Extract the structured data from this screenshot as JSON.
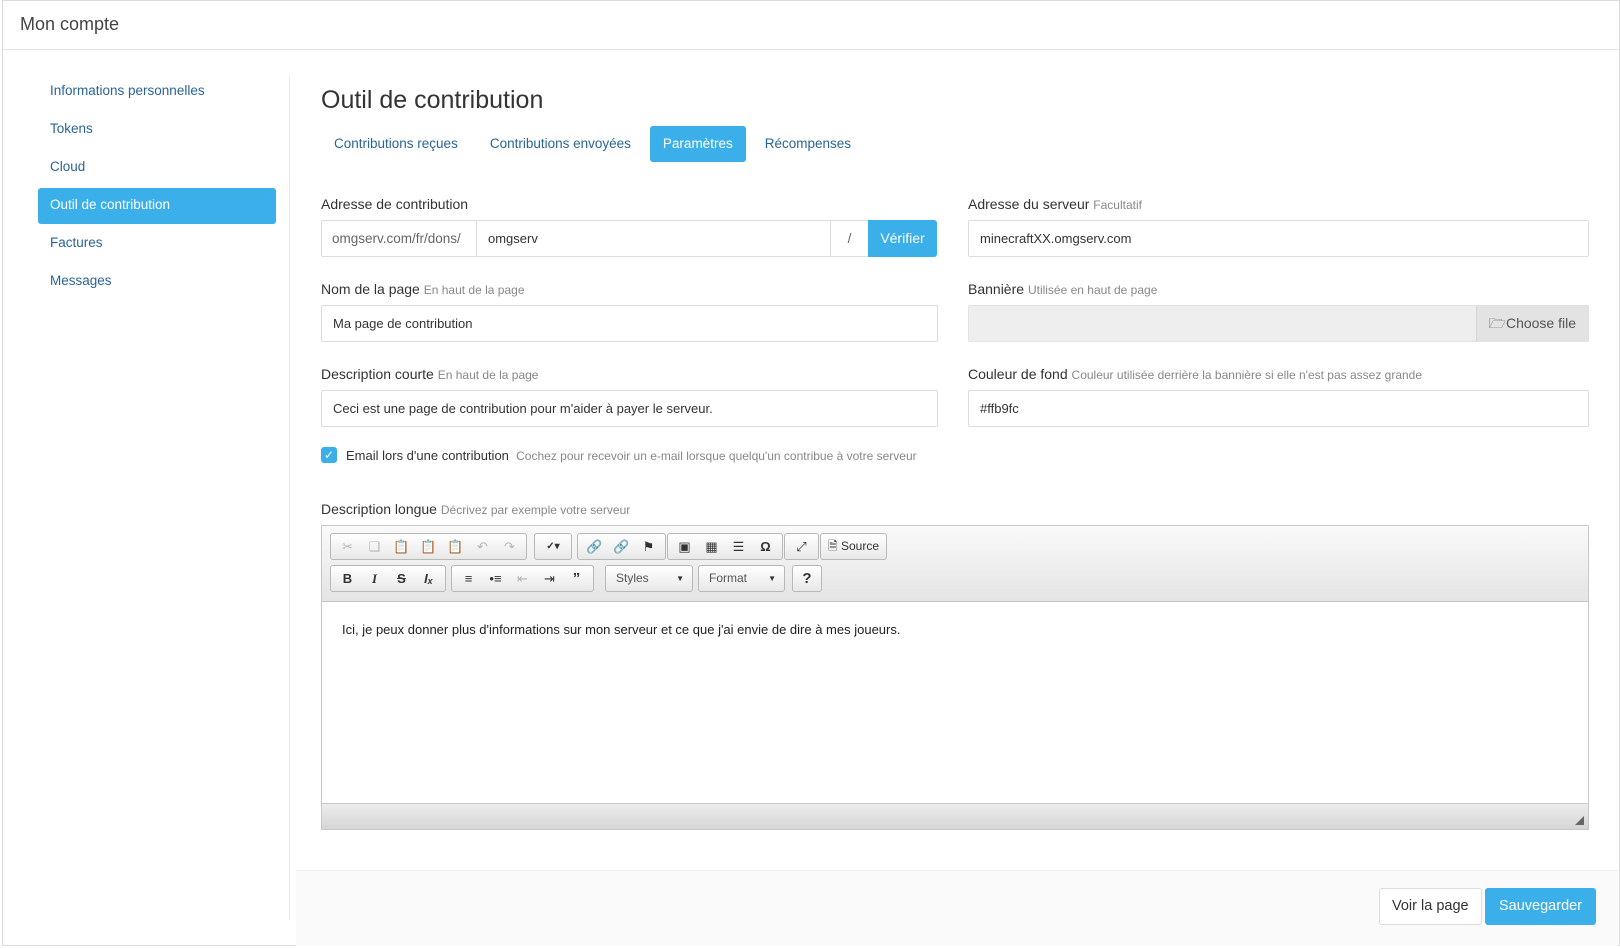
{
  "panel": {
    "title": "Mon compte"
  },
  "sidebar": {
    "items": [
      {
        "label": "Informations personnelles"
      },
      {
        "label": "Tokens"
      },
      {
        "label": "Cloud"
      },
      {
        "label": "Outil de contribution",
        "active": true
      },
      {
        "label": "Factures"
      },
      {
        "label": "Messages"
      }
    ]
  },
  "main": {
    "title": "Outil de contribution",
    "tabs": [
      {
        "label": "Contributions reçues"
      },
      {
        "label": "Contributions envoyées"
      },
      {
        "label": "Paramètres",
        "active": true
      },
      {
        "label": "Récompenses"
      }
    ]
  },
  "form": {
    "contribution_address": {
      "label": "Adresse de contribution",
      "prefix": "omgserv.com/fr/dons/",
      "value": "omgserv",
      "suffix": "/",
      "verify_label": "Vérifier"
    },
    "server_address": {
      "label": "Adresse du serveur",
      "hint": "Facultatif",
      "value": "minecraftXX.omgserv.com"
    },
    "page_name": {
      "label": "Nom de la page",
      "hint": "En haut de la page",
      "value": "Ma page de contribution"
    },
    "banner": {
      "label": "Bannière",
      "hint": "Utilisée en haut de page",
      "button_label": "Choose file"
    },
    "short_description": {
      "label": "Description courte",
      "hint": "En haut de la page",
      "value": "Ceci est une page de contribution pour m'aider à payer le serveur."
    },
    "background_color": {
      "label": "Couleur de fond",
      "hint": "Couleur utilisée derrière la bannière si elle n'est pas assez grande",
      "value": "#ffb9fc"
    },
    "email_notify": {
      "label": "Email lors d'une contribution",
      "hint": "Cochez pour recevoir un e-mail lorsque quelqu'un contribue à votre serveur",
      "checked": true
    },
    "long_description": {
      "label": "Description longue",
      "hint": "Décrivez par exemple votre serveur",
      "content": "Ici, je peux donner plus d'informations sur mon serveur et ce que j'ai envie de dire à mes joueurs.",
      "toolbar": {
        "source_label": "Source",
        "styles_label": "Styles",
        "format_label": "Format",
        "help_label": "?"
      }
    }
  },
  "footer": {
    "view_label": "Voir la page",
    "save_label": "Sauvegarder"
  },
  "colors": {
    "accent": "#3bafea",
    "link": "#2a6496"
  }
}
